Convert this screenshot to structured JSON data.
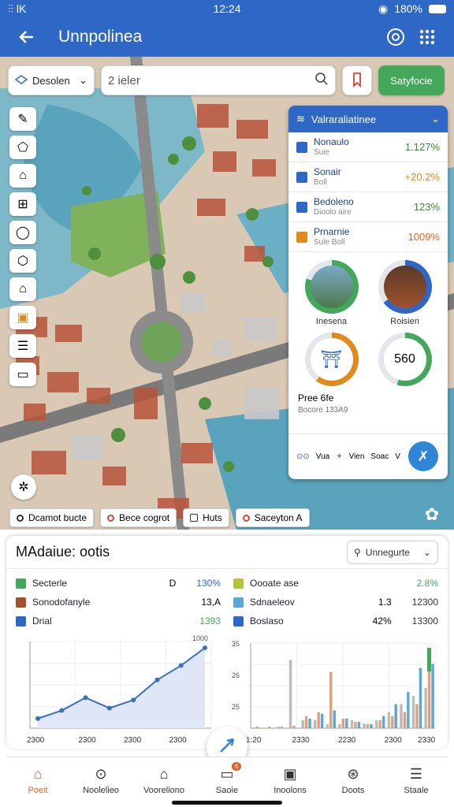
{
  "status": {
    "carrier": "⫶⫶ lK",
    "time": "12:24",
    "battery": "180%"
  },
  "appbar": {
    "title": "Unnpolinea"
  },
  "search": {
    "location_chip": "Desolen",
    "placeholder": "2 ieler",
    "action_label": "Satyfocie"
  },
  "legend": [
    "Dcamot bucte",
    "Bece cogrot",
    "Huts",
    "Saceyton A"
  ],
  "panel": {
    "header": "Valraraliatinee",
    "rows": [
      {
        "name": "Nonaulo",
        "sub": "Suie",
        "value": "1.127%",
        "color": "#3a8a3a",
        "icon_color": "#2f67c7"
      },
      {
        "name": "Sonair",
        "sub": "Boll",
        "value": "+20.2%",
        "color": "#e08a1e",
        "icon_color": "#2f67c7"
      },
      {
        "name": "Bedoleno",
        "sub": "Dioolo aire",
        "value": "123%",
        "color": "#3a8a3a",
        "icon_color": "#2f67c7"
      },
      {
        "name": "Prnarnie",
        "sub": "Sule Boll",
        "value": "1009%",
        "color": "#e0632a",
        "icon_color": "#e08a1e"
      }
    ],
    "gauges": [
      {
        "label": "Inesena",
        "color": "#43a85a",
        "fraction": 0.8
      },
      {
        "label": "Roisien",
        "color": "#2f67c7",
        "fraction": 0.65
      },
      {
        "label": "",
        "color": "#e08a1e",
        "fraction": 0.6
      },
      {
        "label": "",
        "color": "#43a85a",
        "fraction": 0.55
      }
    ],
    "gauge4_text": "560",
    "preview_title": "Pree 6fe",
    "preview_sub": "Bocore 133A9",
    "footer_labels": [
      "Vua",
      "Vien",
      "Soac",
      "V"
    ]
  },
  "sheet": {
    "title": "MAdaiue: ootis",
    "dropdown": "Unnegurte",
    "stats_left": [
      {
        "label": "Secterle",
        "extra": "D",
        "value": "130%",
        "color": "#43a85a",
        "value_color": "#2f67c7"
      },
      {
        "label": "Sonodofanyle",
        "extra": "13,A",
        "value": "",
        "color": "#a0522d",
        "value_color": "#333"
      },
      {
        "label": "Drial",
        "extra": "",
        "value": "1393",
        "color": "#2f67c7",
        "value_color": "#43a85a"
      }
    ],
    "stats_right": [
      {
        "label": "Oooate ase",
        "extra": "",
        "value": "2.8%",
        "color": "#b6c43a",
        "value_color": "#43a85a"
      },
      {
        "label": "Sdnaeleov",
        "extra": "1.3",
        "value": "12300",
        "color": "#5aa8d6",
        "value_color": "#333"
      },
      {
        "label": "Boslaso",
        "extra": "42%",
        "value": "13300",
        "color": "#2f67c7",
        "value_color": "#333"
      }
    ]
  },
  "chart_data": [
    {
      "type": "area",
      "x_ticks": [
        "2300",
        "2300",
        "2300",
        "2300"
      ],
      "y_ticks": [
        "1000"
      ],
      "values": [
        0.12,
        0.22,
        0.38,
        0.25,
        0.35,
        0.6,
        0.78,
        1.0
      ]
    },
    {
      "type": "bar",
      "x_ticks": [
        "1:20",
        "2330",
        "2230",
        "2300",
        "2330"
      ],
      "y_ticks": [
        "35",
        "26",
        "25"
      ],
      "series": [
        {
          "color": "#bbbbbb",
          "values": [
            0,
            0,
            0.02,
            0.85,
            0.1,
            0.1,
            0.05,
            0.05,
            0.1,
            0.06,
            0.1,
            0.2,
            0.3,
            0.4,
            0.5
          ]
        },
        {
          "color": "#e0a07a",
          "values": [
            0.02,
            0.02,
            0.02,
            0.03,
            0.15,
            0.2,
            0.7,
            0.12,
            0.08,
            0.05,
            0.1,
            0.15,
            0.2,
            0.3,
            0.9
          ]
        },
        {
          "color": "#5aa8d6",
          "values": [
            0,
            0,
            0,
            0,
            0.12,
            0.18,
            0.22,
            0.12,
            0.08,
            0.05,
            0.15,
            0.3,
            0.45,
            0.75,
            0.8
          ]
        }
      ]
    }
  ],
  "nav": [
    {
      "label": "Poeit",
      "active": true,
      "badge": ""
    },
    {
      "label": "Noolelieo",
      "active": false,
      "badge": ""
    },
    {
      "label": "Vooreliono",
      "active": false,
      "badge": ""
    },
    {
      "label": "Saoie",
      "active": false,
      "badge": "6"
    },
    {
      "label": "Inoolons",
      "active": false,
      "badge": ""
    },
    {
      "label": "Doots",
      "active": false,
      "badge": ""
    },
    {
      "label": "Staale",
      "active": false,
      "badge": ""
    }
  ]
}
